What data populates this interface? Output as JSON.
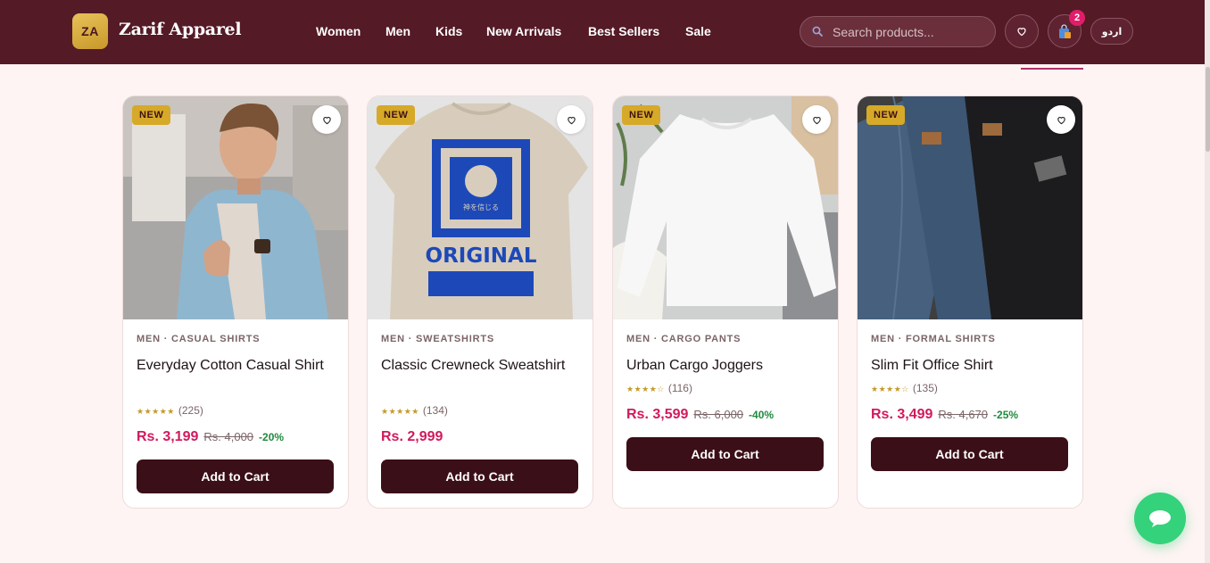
{
  "brand": {
    "initials": "ZA",
    "name": "Zarif Apparel"
  },
  "nav": [
    "Women",
    "Men",
    "Kids",
    "New Arrivals",
    "Best Sellers",
    "Sale"
  ],
  "search": {
    "placeholder": "Search products..."
  },
  "cart": {
    "count": "2"
  },
  "language": {
    "label": "اردو"
  },
  "colors": {
    "header": "#541a26",
    "accent": "#d11a5d",
    "button": "#3b0f18",
    "badge": "#d6a928",
    "discount": "#1f8a3e",
    "chat": "#34d27a"
  },
  "products": [
    {
      "badge": "NEW",
      "category": "MEN · CASUAL SHIRTS",
      "name": "Everyday Cotton Casual Shirt",
      "stars": "★★★★★",
      "reviews": "(225)",
      "price": "Rs. 3,199",
      "old_price": "Rs. 4,000",
      "discount": "-20%",
      "cta": "Add to Cart",
      "image": "man in denim jacket"
    },
    {
      "badge": "NEW",
      "category": "MEN · SWEATSHIRTS",
      "name": "Classic Crewneck Sweatshirt",
      "stars": "★★★★★",
      "reviews": "(134)",
      "price": "Rs. 2,999",
      "old_price": "",
      "discount": "",
      "cta": "Add to Cart",
      "image": "beige printed t-shirt",
      "print_text": "ORIGINAL",
      "print_small": "神を信じる"
    },
    {
      "badge": "NEW",
      "category": "MEN · CARGO PANTS",
      "name": "Urban Cargo Joggers",
      "stars": "★★★★☆",
      "reviews": "(116)",
      "price": "Rs. 3,599",
      "old_price": "Rs. 6,000",
      "discount": "-40%",
      "cta": "Add to Cart",
      "image": "white sweatshirt flat lay"
    },
    {
      "badge": "NEW",
      "category": "MEN · FORMAL SHIRTS",
      "name": "Slim Fit Office Shirt",
      "stars": "★★★★☆",
      "reviews": "(135)",
      "price": "Rs. 3,499",
      "old_price": "Rs. 4,670",
      "discount": "-25%",
      "cta": "Add to Cart",
      "image": "stacked jeans"
    }
  ],
  "icons": {
    "search": "search-icon",
    "wishlist": "heart-icon",
    "cart": "shopping-bag-icon",
    "chat": "chat-bubble-icon"
  }
}
